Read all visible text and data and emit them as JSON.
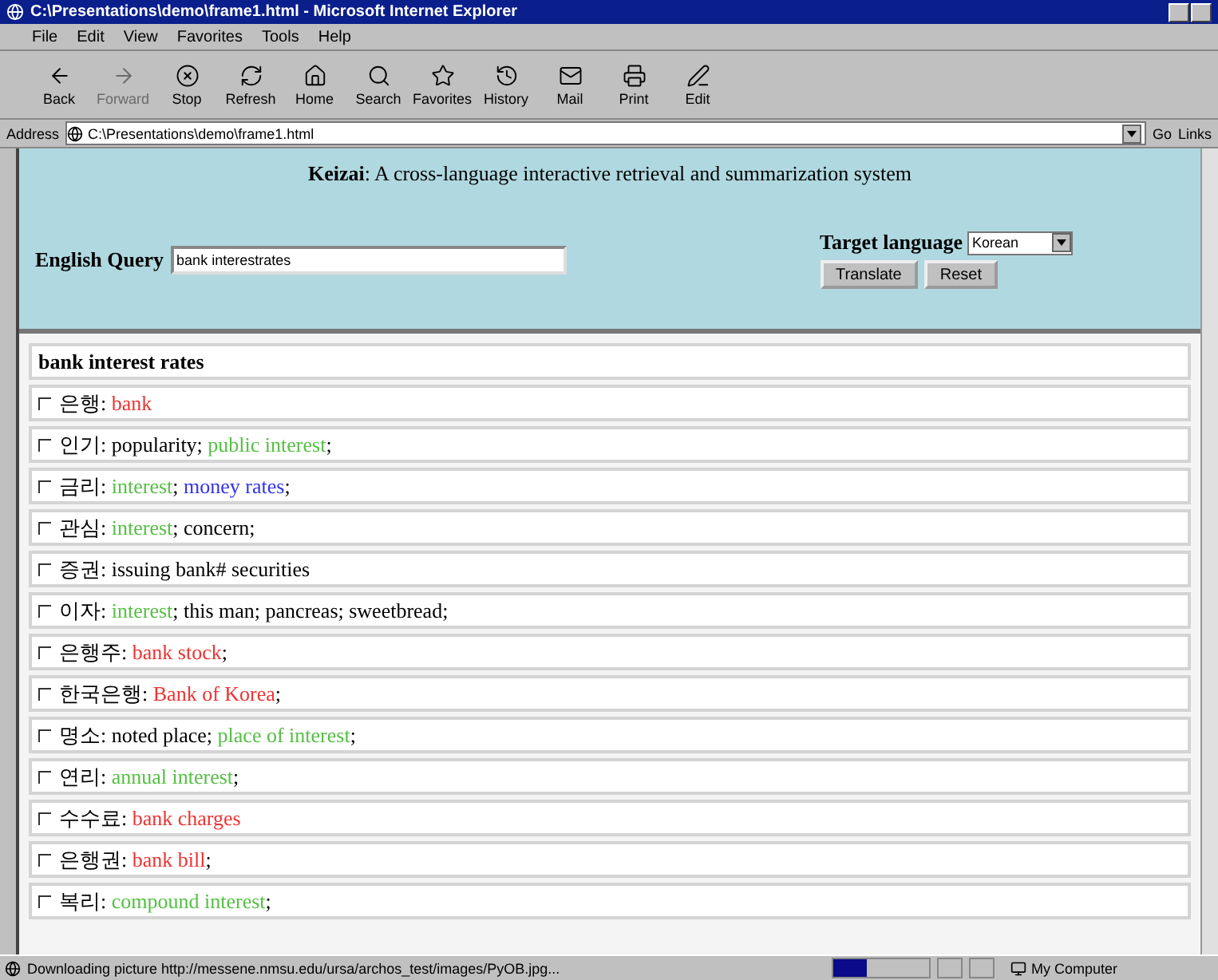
{
  "window": {
    "title": "C:\\Presentations\\demo\\frame1.html - Microsoft Internet Explorer"
  },
  "menu": [
    "File",
    "Edit",
    "View",
    "Favorites",
    "Tools",
    "Help"
  ],
  "toolbar": [
    {
      "label": "Back",
      "disabled": false
    },
    {
      "label": "Forward",
      "disabled": true
    },
    {
      "label": "Stop",
      "disabled": false
    },
    {
      "label": "Refresh",
      "disabled": false
    },
    {
      "label": "Home",
      "disabled": false
    },
    {
      "label": "Search",
      "disabled": false
    },
    {
      "label": "Favorites",
      "disabled": false
    },
    {
      "label": "History",
      "disabled": false
    },
    {
      "label": "Mail",
      "disabled": false
    },
    {
      "label": "Print",
      "disabled": false
    },
    {
      "label": "Edit",
      "disabled": false
    }
  ],
  "address": {
    "label": "Address",
    "value": "C:\\Presentations\\demo\\frame1.html",
    "go": "Go",
    "links": "Links"
  },
  "header": {
    "title": "**Keizai**: A cross-language interactive retrieval and summarization system",
    "query_label": "English Query",
    "query_value": "bank interestrates",
    "target_label": "Target language",
    "target_value": "Korean",
    "buttons": [
      "Translate",
      "Reset"
    ]
  },
  "results": {
    "heading": "bank interest rates",
    "rows": [
      {
        "term": "은행:",
        "checked": false,
        "parts": [
          {
            "text": "bank",
            "color": "#ee3333"
          }
        ]
      },
      {
        "term": "인기:",
        "checked": false,
        "parts": [
          {
            "text": "popularity; ",
            "color": "#000000"
          },
          {
            "text": "public interest",
            "color": "#55c044"
          },
          {
            "text": ";",
            "color": "#000000"
          }
        ]
      },
      {
        "term": "금리:",
        "checked": false,
        "parts": [
          {
            "text": "interest",
            "color": "#55c044"
          },
          {
            "text": "; ",
            "color": "#000000"
          },
          {
            "text": "money rates",
            "color": "#3333ee"
          },
          {
            "text": ";",
            "color": "#000000"
          }
        ]
      },
      {
        "term": "관심:",
        "checked": false,
        "parts": [
          {
            "text": "interest",
            "color": "#55c044"
          },
          {
            "text": "; concern;",
            "color": "#000000"
          }
        ]
      },
      {
        "term": "증권:",
        "checked": false,
        "parts": [
          {
            "text": "issuing bank# securities",
            "color": "#000000"
          }
        ]
      },
      {
        "term": "이자:",
        "checked": false,
        "parts": [
          {
            "text": "interest",
            "color": "#55c044"
          },
          {
            "text": "; this man; pancreas; sweetbread;",
            "color": "#000000"
          }
        ]
      },
      {
        "term": "은행주:",
        "checked": false,
        "parts": [
          {
            "text": "bank stock",
            "color": "#ee3333"
          },
          {
            "text": ";",
            "color": "#000000"
          }
        ]
      },
      {
        "term": "한국은행:",
        "checked": false,
        "parts": [
          {
            "text": "Bank of Korea",
            "color": "#ee3333"
          },
          {
            "text": ";",
            "color": "#000000"
          }
        ]
      },
      {
        "term": "명소:",
        "checked": false,
        "parts": [
          {
            "text": "noted place; ",
            "color": "#000000"
          },
          {
            "text": "place of interest",
            "color": "#55c044"
          },
          {
            "text": ";",
            "color": "#000000"
          }
        ]
      },
      {
        "term": "연리:",
        "checked": false,
        "parts": [
          {
            "text": "annual interest",
            "color": "#55c044"
          },
          {
            "text": ";",
            "color": "#000000"
          }
        ]
      },
      {
        "term": "수수료:",
        "checked": false,
        "parts": [
          {
            "text": "bank charges",
            "color": "#ee3333"
          }
        ]
      },
      {
        "term": "은행권:",
        "checked": false,
        "parts": [
          {
            "text": "bank bill",
            "color": "#ee3333"
          },
          {
            "text": ";",
            "color": "#000000"
          }
        ]
      },
      {
        "term": "복리:",
        "checked": false,
        "parts": [
          {
            "text": "compound interest",
            "color": "#55c044"
          },
          {
            "text": ";",
            "color": "#000000"
          }
        ]
      }
    ]
  },
  "status_bar": {
    "text": "Downloading picture http://messene.nmsu.edu/ursa/archos_test/images/PyOB.jpg...",
    "level": 0.35,
    "zone": "My Computer"
  }
}
